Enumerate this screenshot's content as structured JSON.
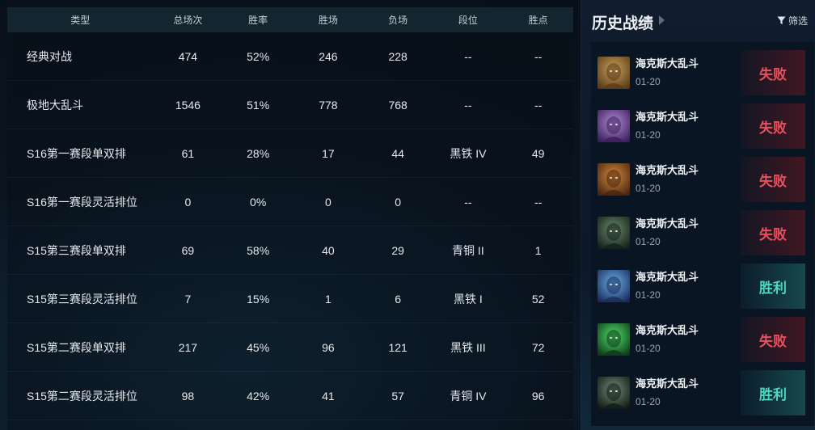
{
  "table": {
    "headers": {
      "type": "类型",
      "total": "总场次",
      "rate": "胜率",
      "wins": "胜场",
      "losses": "负场",
      "tier": "段位",
      "lp": "胜点"
    },
    "rows": [
      {
        "type": "经典对战",
        "total": "474",
        "rate": "52%",
        "wins": "246",
        "losses": "228",
        "tier": "--",
        "lp": "--"
      },
      {
        "type": "极地大乱斗",
        "total": "1546",
        "rate": "51%",
        "wins": "778",
        "losses": "768",
        "tier": "--",
        "lp": "--"
      },
      {
        "type": "S16第一赛段单双排",
        "total": "61",
        "rate": "28%",
        "wins": "17",
        "losses": "44",
        "tier": "黑铁 IV",
        "lp": "49"
      },
      {
        "type": "S16第一赛段灵活排位",
        "total": "0",
        "rate": "0%",
        "wins": "0",
        "losses": "0",
        "tier": "--",
        "lp": "--"
      },
      {
        "type": "S15第三赛段单双排",
        "total": "69",
        "rate": "58%",
        "wins": "40",
        "losses": "29",
        "tier": "青铜 II",
        "lp": "1"
      },
      {
        "type": "S15第三赛段灵活排位",
        "total": "7",
        "rate": "15%",
        "wins": "1",
        "losses": "6",
        "tier": "黑铁 I",
        "lp": "52"
      },
      {
        "type": "S15第二赛段单双排",
        "total": "217",
        "rate": "45%",
        "wins": "96",
        "losses": "121",
        "tier": "黑铁 III",
        "lp": "72"
      },
      {
        "type": "S15第二赛段灵活排位",
        "total": "98",
        "rate": "42%",
        "wins": "41",
        "losses": "57",
        "tier": "青铜 IV",
        "lp": "96"
      }
    ]
  },
  "history": {
    "title": "历史战绩",
    "filter_label": "筛选",
    "matches": [
      {
        "mode": "海克斯大乱斗",
        "date": "01-20",
        "result": "失败",
        "outcome": "lose",
        "champion_icon": "champion-portrait-icon",
        "colors": [
          "#5a3a1a",
          "#c8a25a"
        ]
      },
      {
        "mode": "海克斯大乱斗",
        "date": "01-20",
        "result": "失败",
        "outcome": "lose",
        "champion_icon": "champion-portrait-icon",
        "colors": [
          "#3a1f5a",
          "#b48ad8"
        ]
      },
      {
        "mode": "海克斯大乱斗",
        "date": "01-20",
        "result": "失败",
        "outcome": "lose",
        "champion_icon": "champion-portrait-icon",
        "colors": [
          "#4a2412",
          "#d08a3a"
        ]
      },
      {
        "mode": "海克斯大乱斗",
        "date": "01-20",
        "result": "失败",
        "outcome": "lose",
        "champion_icon": "champion-portrait-icon",
        "colors": [
          "#14201a",
          "#6a8a6a"
        ]
      },
      {
        "mode": "海克斯大乱斗",
        "date": "01-20",
        "result": "胜利",
        "outcome": "win",
        "champion_icon": "champion-portrait-icon",
        "colors": [
          "#1a2a5a",
          "#6ab0e8"
        ]
      },
      {
        "mode": "海克斯大乱斗",
        "date": "01-20",
        "result": "失败",
        "outcome": "lose",
        "champion_icon": "champion-portrait-icon",
        "colors": [
          "#0f3a18",
          "#4ee06a"
        ]
      },
      {
        "mode": "海克斯大乱斗",
        "date": "01-20",
        "result": "胜利",
        "outcome": "win",
        "champion_icon": "champion-portrait-icon",
        "colors": [
          "#121a16",
          "#6e8a72"
        ]
      }
    ]
  }
}
